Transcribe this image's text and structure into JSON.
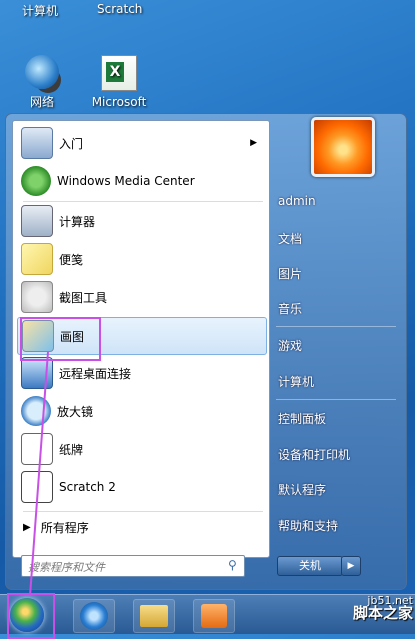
{
  "desktop": {
    "top_labels": [
      "计算机",
      "Scratch"
    ],
    "icons": [
      {
        "label": "网络",
        "icon": "network-icon"
      },
      {
        "label": "Microsoft",
        "icon": "excel-icon"
      }
    ]
  },
  "start_menu": {
    "left_items": [
      {
        "label": "入门",
        "icon": "getting-started-icon",
        "has_submenu": true
      },
      {
        "label": "Windows Media Center",
        "icon": "media-center-icon"
      },
      {
        "label": "计算器",
        "icon": "calculator-icon"
      },
      {
        "label": "便笺",
        "icon": "sticky-notes-icon"
      },
      {
        "label": "截图工具",
        "icon": "snipping-tool-icon"
      },
      {
        "label": "画图",
        "icon": "paint-icon",
        "selected": true
      },
      {
        "label": "远程桌面连接",
        "icon": "remote-desktop-icon"
      },
      {
        "label": "放大镜",
        "icon": "magnifier-icon"
      },
      {
        "label": "纸牌",
        "icon": "solitaire-icon"
      },
      {
        "label": "Scratch 2",
        "icon": "scratch-icon"
      }
    ],
    "all_programs": "所有程序",
    "search_placeholder": "搜索程序和文件",
    "right_items": [
      "admin",
      "文档",
      "图片",
      "音乐",
      "游戏",
      "计算机",
      "控制面板",
      "设备和打印机",
      "默认程序",
      "帮助和支持"
    ],
    "shutdown_label": "关机"
  },
  "taskbar": {
    "buttons": [
      "start-orb",
      "internet-explorer-icon",
      "file-explorer-icon",
      "media-player-icon"
    ]
  },
  "watermark": {
    "line1": "jb51.net",
    "line2": "脚本之家"
  },
  "colors": {
    "highlight": "#c850e6"
  }
}
